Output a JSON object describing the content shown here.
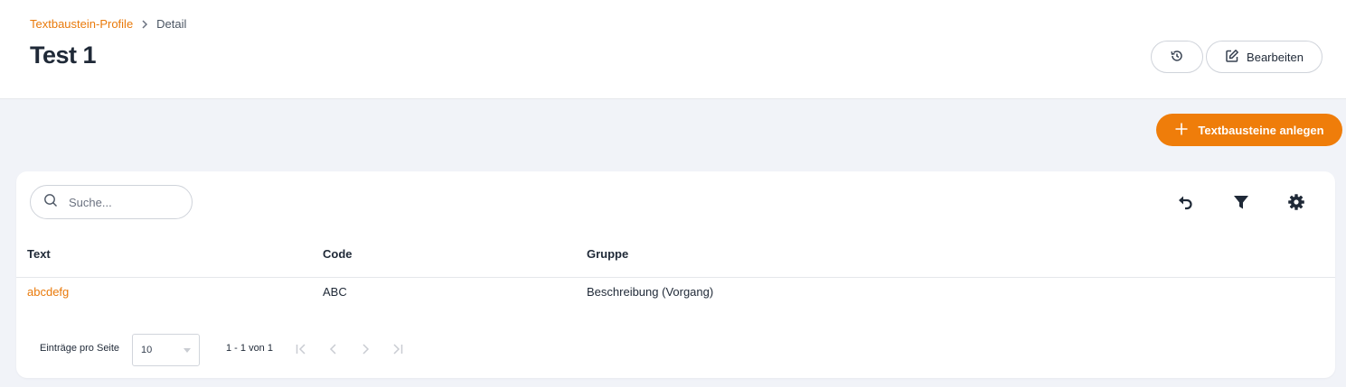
{
  "header": {
    "breadcrumb": {
      "parent": "Textbaustein-Profile",
      "current": "Detail"
    },
    "title": "Test 1",
    "history_icon": "history-icon",
    "edit_label": "Bearbeiten",
    "edit_icon": "edit-icon"
  },
  "actions": {
    "create_label": "Textbausteine anlegen",
    "create_icon": "plus-icon"
  },
  "table": {
    "search": {
      "placeholder": "Suche...",
      "value": ""
    },
    "tools": [
      "undo-icon",
      "filter-icon",
      "gear-icon"
    ],
    "columns": [
      "Text",
      "Code",
      "Gruppe"
    ],
    "rows": [
      {
        "text": "abcdefg",
        "code": "ABC",
        "gruppe": "Beschreibung (Vorgang)"
      }
    ],
    "pagination": {
      "per_page_label": "Einträge pro Seite",
      "per_page_value": "10",
      "range": "1 - 1 von 1"
    }
  },
  "colors": {
    "accent": "#ef7d0a",
    "link": "#e97a0b",
    "background": "#f1f3f8"
  }
}
